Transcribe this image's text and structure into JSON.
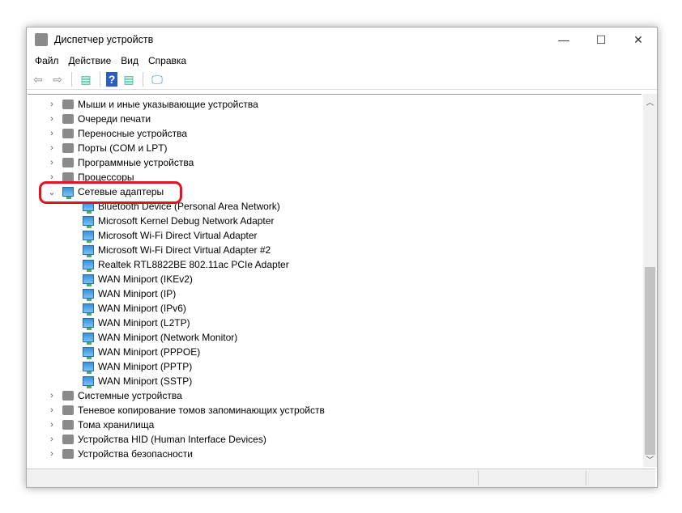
{
  "window": {
    "title": "Диспетчер устройств",
    "minimize": "—",
    "maximize": "☐",
    "close": "✕"
  },
  "menu": [
    "Файл",
    "Действие",
    "Вид",
    "Справка"
  ],
  "toolbar": [
    {
      "name": "back",
      "glyph": "⇦"
    },
    {
      "name": "forward",
      "glyph": "⇨"
    },
    {
      "name": "properties",
      "glyph": "▤"
    },
    {
      "name": "help",
      "glyph": "?"
    },
    {
      "name": "update-driver",
      "glyph": "▤"
    },
    {
      "name": "scan-hardware",
      "glyph": "🖵"
    }
  ],
  "tree": {
    "before": [
      {
        "label": "Мыши и иные указывающие устройства"
      },
      {
        "label": "Очереди печати"
      },
      {
        "label": "Переносные устройства"
      },
      {
        "label": "Порты (COM и LPT)"
      },
      {
        "label": "Программные устройства"
      },
      {
        "label": "Процессоры"
      }
    ],
    "expanded": {
      "label": "Сетевые адаптеры",
      "children": [
        "Bluetooth Device (Personal Area Network)",
        "Microsoft Kernel Debug Network Adapter",
        "Microsoft Wi-Fi Direct Virtual Adapter",
        "Microsoft Wi-Fi Direct Virtual Adapter #2",
        "Realtek RTL8822BE 802.11ac PCIe Adapter",
        "WAN Miniport (IKEv2)",
        "WAN Miniport (IP)",
        "WAN Miniport (IPv6)",
        "WAN Miniport (L2TP)",
        "WAN Miniport (Network Monitor)",
        "WAN Miniport (PPPOE)",
        "WAN Miniport (PPTP)",
        "WAN Miniport (SSTP)"
      ]
    },
    "after": [
      {
        "label": "Системные устройства"
      },
      {
        "label": "Теневое копирование томов запоминающих устройств"
      },
      {
        "label": "Тома хранилища"
      },
      {
        "label": "Устройства HID (Human Interface Devices)"
      },
      {
        "label": "Устройства безопасности"
      }
    ]
  },
  "colors": {
    "highlight": "#e0141e"
  }
}
